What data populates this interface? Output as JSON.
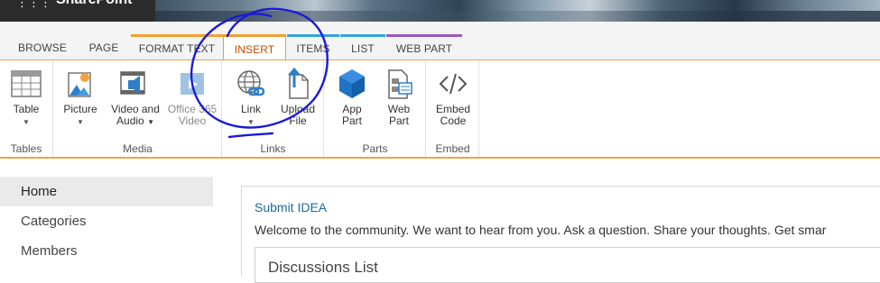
{
  "suite": {
    "brand": "SharePoint",
    "waffle_icon": "app-launcher-icon"
  },
  "tabs": [
    {
      "label": "BROWSE"
    },
    {
      "label": "PAGE"
    },
    {
      "label": "FORMAT TEXT",
      "accent": "#f0a030"
    },
    {
      "label": "INSERT",
      "accent": "#f0a030",
      "active": true,
      "color": "#c44e00"
    },
    {
      "label": "ITEMS",
      "accent": "#36a3d9"
    },
    {
      "label": "LIST",
      "accent": "#36a3d9"
    },
    {
      "label": "WEB PART",
      "accent": "#9b59b6"
    }
  ],
  "ribbon": {
    "groups": [
      {
        "name": "Tables",
        "buttons": [
          {
            "label": "Table",
            "icon": "table-icon",
            "dropdown": true
          }
        ]
      },
      {
        "name": "Media",
        "buttons": [
          {
            "label": "Picture",
            "icon": "picture-icon",
            "dropdown": true
          },
          {
            "label": "Video and Audio",
            "line1": "Video and",
            "line2": "Audio",
            "icon": "video-audio-icon",
            "dropdown": true
          },
          {
            "label": "Office 365 Video",
            "line1": "Office 365",
            "line2": "Video",
            "icon": "office365-video-icon",
            "disabled": true
          }
        ]
      },
      {
        "name": "Links",
        "buttons": [
          {
            "label": "Link",
            "icon": "link-icon",
            "dropdown": true
          },
          {
            "label": "Upload File",
            "line1": "Upload",
            "line2": "File",
            "icon": "upload-file-icon"
          }
        ]
      },
      {
        "name": "Parts",
        "buttons": [
          {
            "label": "App Part",
            "line1": "App",
            "line2": "Part",
            "icon": "app-part-icon"
          },
          {
            "label": "Web Part",
            "line1": "Web",
            "line2": "Part",
            "icon": "web-part-icon"
          }
        ]
      },
      {
        "name": "Embed",
        "buttons": [
          {
            "label": "Embed Code",
            "line1": "Embed",
            "line2": "Code",
            "icon": "embed-code-icon"
          }
        ]
      }
    ],
    "accent": "#e6a64a"
  },
  "leftnav": {
    "items": [
      {
        "label": "Home",
        "selected": true
      },
      {
        "label": "Categories"
      },
      {
        "label": "Members"
      }
    ]
  },
  "content": {
    "title": "Submit IDEA",
    "welcome": "Welcome to the community. We want to hear from you. Ask a question. Share your thoughts. Get smar",
    "panel_title": "Discussions List"
  },
  "annotation": {
    "color": "#1a1ad6",
    "shape": "hand-drawn circle around Link button"
  }
}
